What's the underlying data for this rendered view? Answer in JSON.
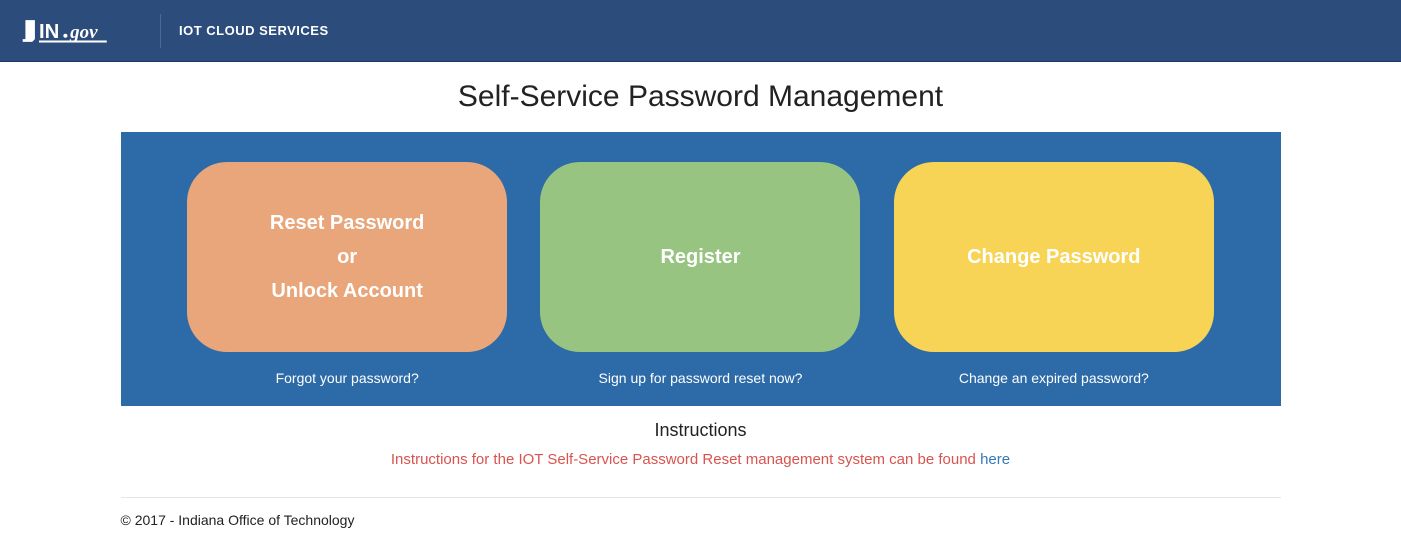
{
  "header": {
    "logo_text": "IN.gov",
    "subtitle": "IOT CLOUD SERVICES"
  },
  "page": {
    "heading": "Self-Service Password Management"
  },
  "actions": {
    "reset": {
      "line1": "Reset Password",
      "line2": "or",
      "line3": "Unlock Account",
      "caption": "Forgot your password?"
    },
    "register": {
      "line1": "Register",
      "caption": "Sign up for password reset now?"
    },
    "change": {
      "line1": "Change Password",
      "caption": "Change an expired password?"
    }
  },
  "instructions": {
    "heading": "Instructions",
    "text": "Instructions for the IOT Self-Service Password Reset management system can be found ",
    "link_label": "here"
  },
  "footer": {
    "copyright": "© 2017 - Indiana Office of Technology"
  }
}
